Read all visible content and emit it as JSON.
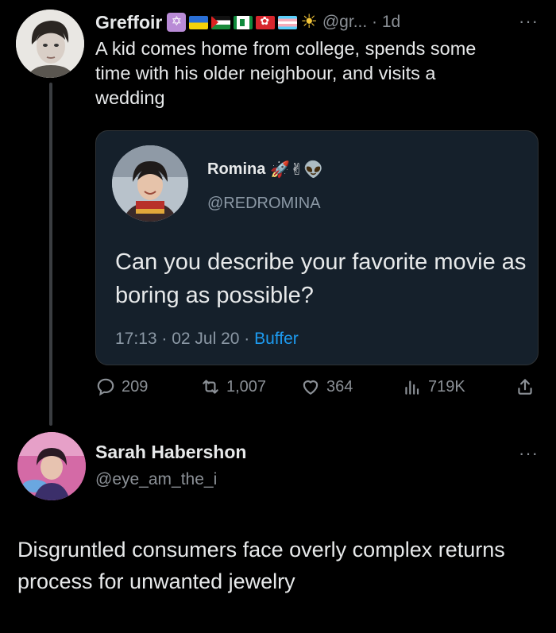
{
  "tweet1": {
    "author_name": "Greffoir",
    "handle_time": "@gr... · 1d",
    "more": "···",
    "text": "A kid comes home from college, spends some time with his older neighbour, and visits a wedding",
    "badges": [
      "star-of-david-emoji",
      "ukraine-flag",
      "palestine-flag",
      "green-white-flag",
      "hong-kong-flag",
      "trans-flag",
      "sun-emoji"
    ],
    "quoted": {
      "author_name": "Romina",
      "author_emojis": "🚀✌👽",
      "handle": "@REDROMINA",
      "text": "Can you describe your favorite movie as boring as possible?",
      "meta_time": "17:13 · 02 Jul 20 · ",
      "meta_source": "Buffer"
    },
    "actions": {
      "replies": "209",
      "retweets": "1,007",
      "likes": "364",
      "views": "719K"
    }
  },
  "tweet2": {
    "author_name": "Sarah Habershon",
    "handle": "@eye_am_the_i",
    "more": "···",
    "text": "Disgruntled consumers face overly complex returns process for unwanted jewelry"
  },
  "colors": {
    "background": "#000000",
    "text": "#e7e9ea",
    "muted": "#8b9096",
    "quote_bg": "#15202b",
    "link": "#1d9bf0"
  }
}
